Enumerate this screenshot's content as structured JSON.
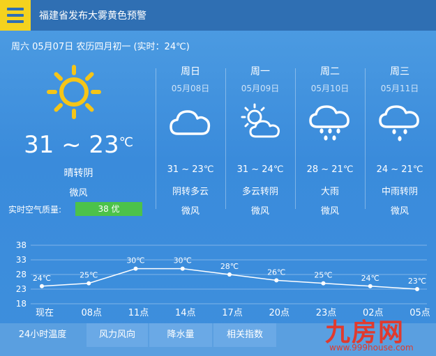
{
  "header": {
    "alert": "福建省发布大雾黄色预警"
  },
  "date_line": "周六 05月07日 农历四月初一 (实时：24℃)",
  "today": {
    "temp_range": "31 ~ 23",
    "unit": "℃",
    "condition": "晴转阴",
    "wind": "微风",
    "aq_label": "实时空气质量:",
    "aq_value": "38 优"
  },
  "forecast": [
    {
      "day": "周日",
      "date": "05月08日",
      "icon": "cloud-icon",
      "temp": "31 ~ 23℃",
      "condition": "阴转多云",
      "wind": "微风"
    },
    {
      "day": "周一",
      "date": "05月09日",
      "icon": "partly-cloudy-icon",
      "temp": "31 ~ 24℃",
      "condition": "多云转阴",
      "wind": "微风"
    },
    {
      "day": "周二",
      "date": "05月10日",
      "icon": "rain-icon",
      "temp": "28 ~ 21℃",
      "condition": "大雨",
      "wind": "微风"
    },
    {
      "day": "周三",
      "date": "05月11日",
      "icon": "rain-icon",
      "temp": "24 ~ 21℃",
      "condition": "中雨转阴",
      "wind": "微风"
    }
  ],
  "chart_data": {
    "type": "line",
    "categories": [
      "现在",
      "08点",
      "11点",
      "14点",
      "17点",
      "20点",
      "23点",
      "02点",
      "05点"
    ],
    "values": [
      24,
      25,
      30,
      30,
      28,
      26,
      25,
      24,
      23
    ],
    "value_labels": [
      "24℃",
      "25℃",
      "30℃",
      "30℃",
      "28℃",
      "26℃",
      "25℃",
      "24℃",
      "23℃"
    ],
    "yticks": [
      38,
      33,
      28,
      23,
      18
    ],
    "ylim": [
      18,
      38
    ],
    "grid": true
  },
  "tabs": [
    {
      "label": "24小时温度"
    },
    {
      "label": "风力风向"
    },
    {
      "label": "降水量"
    },
    {
      "label": "相关指数"
    }
  ],
  "watermark": {
    "brand": "九房网",
    "url": "www.999house.com"
  },
  "colors": {
    "accent": "#f4d21e",
    "good": "#4cc24a",
    "sun": "#f5c518"
  }
}
